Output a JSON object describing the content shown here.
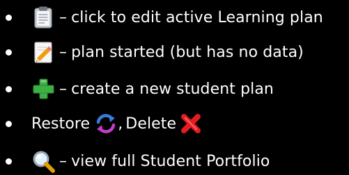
{
  "legend": {
    "items": [
      {
        "icon": "clipboard-icon",
        "separator": "–",
        "text": "click to edit active Learning plan"
      },
      {
        "icon": "pencil-note-icon",
        "separator": "–",
        "text": "plan started (but has no data)"
      },
      {
        "icon": "green-plus-icon",
        "separator": "–",
        "text": "create a new student plan"
      },
      {
        "restore_label": "Restore",
        "restore_icon": "refresh-arrows-icon",
        "comma": ",",
        "delete_label": "Delete",
        "delete_icon": "red-x-icon"
      },
      {
        "icon": "magnifier-icon",
        "separator": "–",
        "text": "view full Student Portfolio"
      }
    ]
  },
  "colors": {
    "background": "#000000",
    "text": "#ffffff",
    "plus_green": "#3cb043",
    "delete_red": "#e11b22"
  }
}
